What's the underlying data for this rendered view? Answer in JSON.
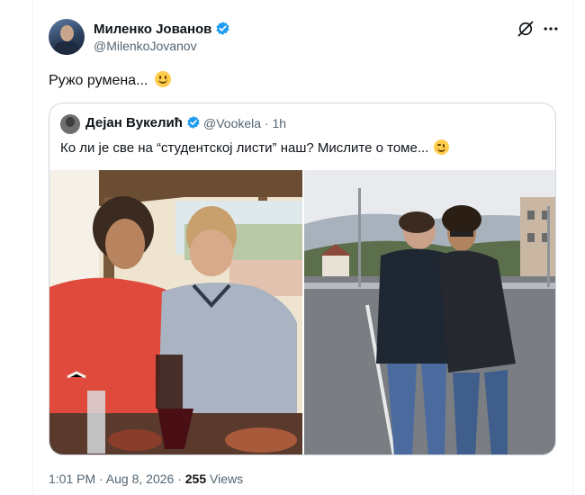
{
  "tweet": {
    "display_name": "Миленко Јованов",
    "handle": "@MilenkoJovanov",
    "text": "Ружо румена...",
    "timestamp": "1:01 PM · Aug 8, 2026 · ",
    "views_count": "255",
    "views_label": " Views"
  },
  "quote": {
    "display_name": "Дејан Вукелић",
    "handle": "@Vookela",
    "time": "· 1h",
    "text": "Ко ли је све на “студентској листи” наш? Мислите о томе..."
  },
  "colors": {
    "verified": "#1d9bf0",
    "text_primary": "#0f1419",
    "text_secondary": "#536471",
    "border": "#cfd9de"
  },
  "icons": [
    "verified-badge-icon",
    "grok-icon",
    "more-icon",
    "smile-emoji",
    "wink-emoji"
  ]
}
